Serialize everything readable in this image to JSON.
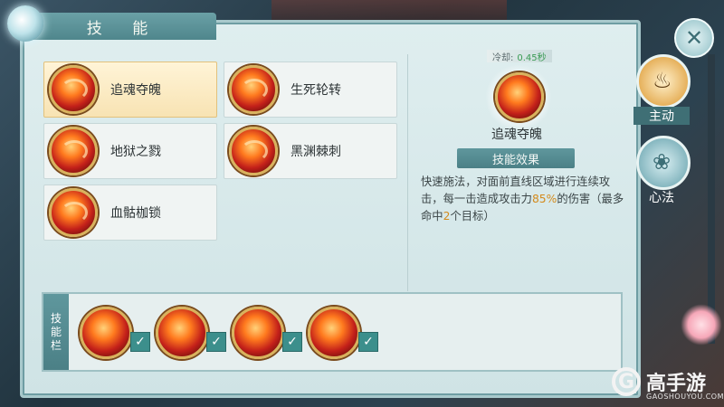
{
  "window": {
    "title": "技 能"
  },
  "skills": [
    {
      "name": "追魂夺魄",
      "selected": true
    },
    {
      "name": "生死轮转",
      "selected": false
    },
    {
      "name": "地狱之戮",
      "selected": false
    },
    {
      "name": "黑渊棘刺",
      "selected": false
    },
    {
      "name": "血骷枷锁",
      "selected": false
    }
  ],
  "detail": {
    "cooldown_label": "冷却:",
    "cooldown_value": "0.45秒",
    "name": "追魂夺魄",
    "effect_header": "技能效果",
    "desc_part1": "快速施法，对面前直线区域进行连续攻击，每一击造成攻击力",
    "desc_highlight_1": "85%",
    "desc_part2": "的伤害（最多命中",
    "desc_highlight_2": "2",
    "desc_part3": "个目标）"
  },
  "tray": {
    "label_chars": [
      "技",
      "能",
      "栏"
    ],
    "slots": [
      "追魂夺魄",
      "地狱之戮",
      "黑渊棘刺",
      "血骷枷锁"
    ]
  },
  "side_tabs": {
    "active": "主动",
    "inactive": "心法"
  },
  "watermark": {
    "brand": "高手游",
    "domain": "GAOSHOUYOU.COM"
  },
  "colors": {
    "accent": "#4f868c",
    "highlight": "#d48a1c",
    "selected_bg": "#f8e3b3"
  },
  "icons": {
    "close": "close-icon",
    "active_tab": "gourd-icon",
    "inactive_tab": "lotus-icon"
  }
}
